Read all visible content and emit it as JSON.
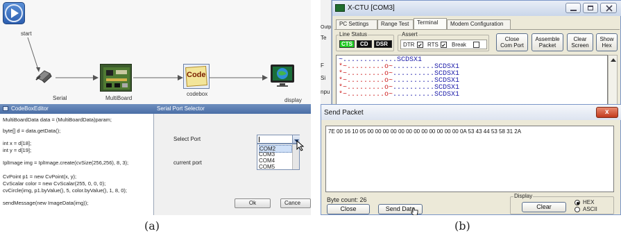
{
  "panel_a": {
    "caption": "(a)",
    "nodes": {
      "start": "start",
      "serial": "Serial",
      "multiboard": "MultiBoard",
      "codebox": "codebox",
      "display": "display",
      "code_icon_text": "Code"
    },
    "editor": {
      "title": "CodeBoxEditor",
      "lines": [
        "MultiBoardData data = (MultiBoardData)param;",
        "byte[] d = data.getData();",
        "int x = d[18];",
        "int y = d[19];",
        "IplImage img = IplImage.create(cvSize(256,256), 8, 3);",
        "CvPoint p1 = new CvPoint(x, y);",
        "CvScalar color = new CvScalar(255, 0, 0, 0);",
        "cvCircle(img, p1.byValue(), 5, color.byValue(), 1, 8, 0);",
        "sendMessage(new ImageData(img));"
      ]
    },
    "port_selector": {
      "title": "Serial Port Selector",
      "select_port_label": "Select Port",
      "current_port_label": "current port",
      "options": [
        "COM2",
        "COM3",
        "COM4",
        "COM5"
      ],
      "ok": "Ok",
      "cancel": "Cance"
    }
  },
  "panel_b": {
    "caption": "(b)",
    "window_title": "X-CTU  [COM3]",
    "side_fragments": [
      "Outp",
      "Te",
      "F",
      "Si",
      "npu"
    ],
    "tabs": [
      "PC Settings",
      "Range Test",
      "Terminal",
      "Modem Configuration"
    ],
    "active_tab": "Terminal",
    "line_status": {
      "legend": "Line Status",
      "cts": "CTS",
      "cd": "CD",
      "dsr": "DSR",
      "cts_color": "#22cc22"
    },
    "assert": {
      "legend": "Assert",
      "dtr": "DTR",
      "rts": "RTS",
      "break": "Break",
      "dtr_checked": true,
      "rts_checked": true,
      "break_checked": false
    },
    "buttons": {
      "close_com_port_1": "Close",
      "close_com_port_2": "Com Port",
      "assemble_1": "Assemble",
      "assemble_2": "Packet",
      "clear_screen_1": "Clear",
      "clear_screen_2": "Screen",
      "show_hex_1": "Show",
      "show_hex_2": "Hex"
    },
    "terminal_lines": [
      {
        "a": "~.............",
        "b": "SCDSX1",
        "red": false
      },
      {
        "a": "*~.........",
        "mid": "o~",
        "c": "..........",
        "b": "SCDSX1",
        "red": true
      },
      {
        "a": "*~.........",
        "mid": "o~",
        "c": "..........",
        "b": "SCDSX1",
        "red": true
      },
      {
        "a": "*~.........",
        "mid": "o~",
        "c": "..........",
        "b": "SCDSX1",
        "red": true
      },
      {
        "a": "*~.........",
        "mid": "o~",
        "c": "..........",
        "b": "SCDSX1",
        "red": true
      },
      {
        "a": "*~.........",
        "mid": "o~",
        "c": "..........",
        "b": "SCDSX1",
        "red": true
      }
    ],
    "send_packet": {
      "title": "Send Packet",
      "close_x": "x",
      "hex_payload": "7E 00 16 10 05 00 00 00 00 00 00 00 00 00 00 00 00 0A 53 43 44 53 58 31 2A",
      "byte_count": "Byte count: 26",
      "close": "Close",
      "send_data": "Send Data",
      "display_legend": "Display",
      "clear": "Clear",
      "hex": "HEX",
      "ascii": "ASCII",
      "hex_selected": true
    }
  }
}
